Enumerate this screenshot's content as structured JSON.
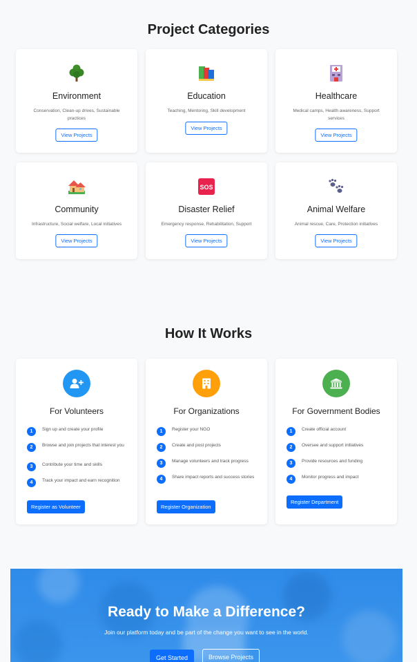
{
  "categories_section": {
    "title": "Project Categories",
    "cards": [
      {
        "icon": "tree-icon",
        "title": "Environment",
        "description": "Conservation, Clean-up drives, Sustainable practices",
        "button": "View Projects"
      },
      {
        "icon": "books-icon",
        "title": "Education",
        "description": "Teaching, Mentoring, Skill development",
        "button": "View Projects"
      },
      {
        "icon": "hospital-icon",
        "title": "Healthcare",
        "description": "Medical camps, Health awareness, Support services",
        "button": "View Projects"
      },
      {
        "icon": "houses-icon",
        "title": "Community",
        "description": "Infrastructure, Social welfare, Local initiatives",
        "button": "View Projects"
      },
      {
        "icon": "sos-icon",
        "title": "Disaster Relief",
        "description": "Emergency response, Rehabilitation, Support",
        "button": "View Projects"
      },
      {
        "icon": "paw-prints-icon",
        "title": "Animal Welfare",
        "description": "Animal rescue, Care, Protection initiatives",
        "button": "View Projects"
      }
    ]
  },
  "how_section": {
    "title": "How It Works",
    "cards": [
      {
        "icon": "user-plus-icon",
        "icon_color": "#2196f3",
        "title": "For Volunteers",
        "steps": [
          {
            "num": "1",
            "text": "Sign up and create your profile"
          },
          {
            "num": "2",
            "text": "Browse and join projects that interest you"
          },
          {
            "num": "3",
            "text": "Contribute your time and skills"
          },
          {
            "num": "4",
            "text": "Track your impact and earn recognition"
          }
        ],
        "button": "Register as Volunteer"
      },
      {
        "icon": "building-icon",
        "icon_color": "#ff9f0a",
        "title": "For Organizations",
        "steps": [
          {
            "num": "1",
            "text": "Register your NGO"
          },
          {
            "num": "2",
            "text": "Create and post projects"
          },
          {
            "num": "3",
            "text": "Manage volunteers and track progress"
          },
          {
            "num": "4",
            "text": "Share impact reports and success stories"
          }
        ],
        "button": "Register Organization"
      },
      {
        "icon": "landmark-icon",
        "icon_color": "#4caf50",
        "title": "For Government Bodies",
        "steps": [
          {
            "num": "1",
            "text": "Create official account"
          },
          {
            "num": "2",
            "text": "Oversee and support initiatives"
          },
          {
            "num": "3",
            "text": "Provide resources and funding"
          },
          {
            "num": "4",
            "text": "Monitor progress and impact"
          }
        ],
        "button": "Register Department"
      }
    ]
  },
  "cta": {
    "title": "Ready to Make a Difference?",
    "subtitle": "Join our platform today and be part of the change you want to see in the world.",
    "primary_button": "Get Started",
    "secondary_button": "Browse Projects",
    "background_color": "#2f8be9"
  },
  "colors": {
    "primary": "#0d6efd",
    "background": "#f8f9fa"
  }
}
